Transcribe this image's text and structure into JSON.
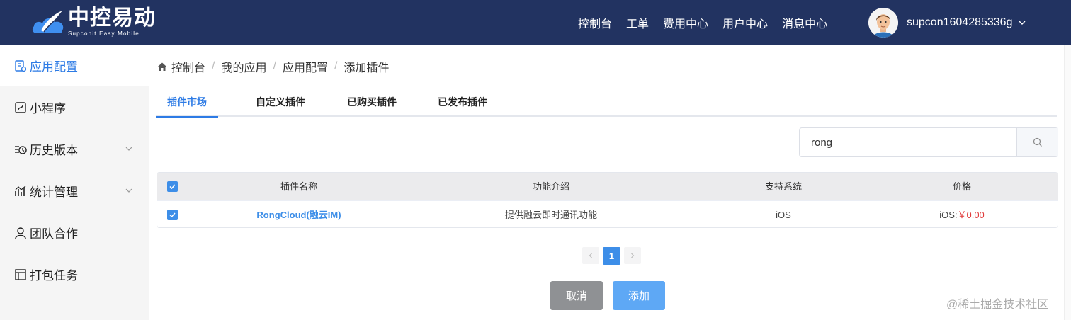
{
  "header": {
    "logo_cn": "中控易动",
    "logo_en": "Supconit Easy Mobile",
    "nav": [
      "控制台",
      "工单",
      "费用中心",
      "用户中心",
      "消息中心"
    ],
    "username": "supcon1604285336g"
  },
  "sidebar": {
    "items": [
      {
        "label": "应用配置",
        "icon": "app-config-icon"
      },
      {
        "label": "小程序",
        "icon": "mini-program-icon"
      },
      {
        "label": "历史版本",
        "icon": "history-icon"
      },
      {
        "label": "统计管理",
        "icon": "statistics-icon"
      },
      {
        "label": "团队合作",
        "icon": "team-icon"
      },
      {
        "label": "打包任务",
        "icon": "package-icon"
      }
    ]
  },
  "breadcrumb": [
    "控制台",
    "我的应用",
    "应用配置",
    "添加插件"
  ],
  "tabs": [
    "插件市场",
    "自定义插件",
    "已购买插件",
    "已发布插件"
  ],
  "search": {
    "value": "rong"
  },
  "table": {
    "headers": [
      "插件名称",
      "功能介绍",
      "支持系统",
      "价格"
    ],
    "rows": [
      {
        "name": "RongCloud(融云IM)",
        "desc": "提供融云即时通讯功能",
        "system": "iOS",
        "price_label": "iOS:",
        "price_value": "￥0.00"
      }
    ]
  },
  "pagination": {
    "current": "1"
  },
  "actions": {
    "cancel": "取消",
    "add": "添加"
  },
  "watermark": "@稀土掘金技术社区",
  "colors": {
    "header_bg": "#223361",
    "accent": "#2d7be5",
    "price": "#e03a3a"
  }
}
